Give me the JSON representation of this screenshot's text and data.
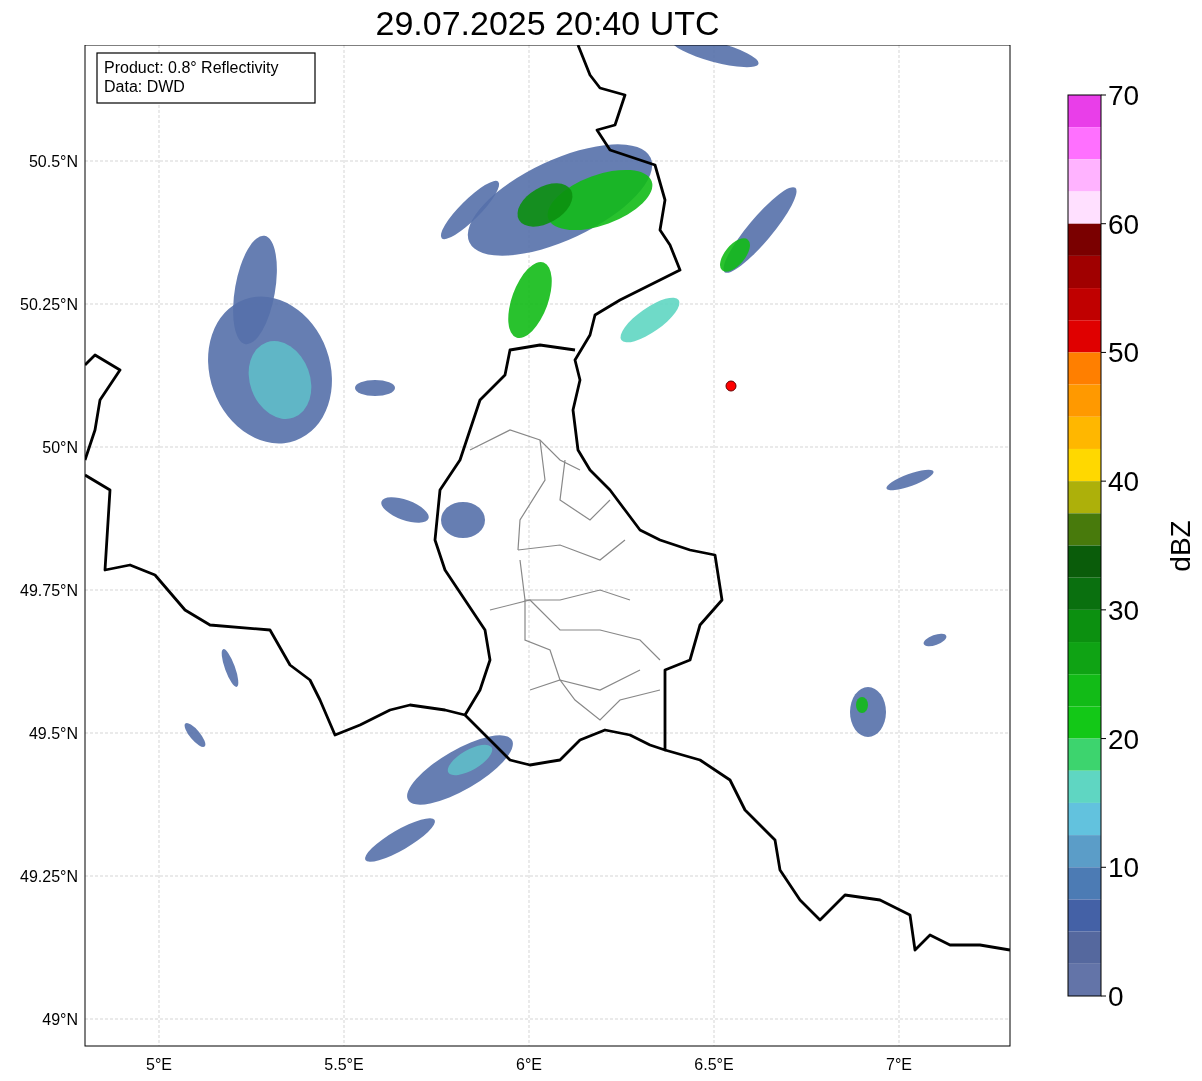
{
  "title": "29.07.2025 20:40 UTC",
  "info_box": {
    "lines": [
      "Product: 0.8° Reflectivity",
      "Data: DWD"
    ]
  },
  "map": {
    "y_ticks": [
      "50.5°N",
      "50.25°N",
      "50°N",
      "49.75°N",
      "49.5°N",
      "49.25°N",
      "49°N"
    ],
    "x_ticks": [
      "5°E",
      "5.5°E",
      "6°E",
      "6.5°E",
      "7°E"
    ]
  },
  "colorbar": {
    "label": "dBZ",
    "ticks": [
      "70",
      "60",
      "50",
      "40",
      "30",
      "20",
      "10",
      "0"
    ],
    "bins": [
      {
        "color": "#e93ee9"
      },
      {
        "color": "#ff70ff"
      },
      {
        "color": "#ffb3ff"
      },
      {
        "color": "#ffe0ff"
      },
      {
        "color": "#7a0000"
      },
      {
        "color": "#a00000"
      },
      {
        "color": "#c00000"
      },
      {
        "color": "#e00000"
      },
      {
        "color": "#ff7f00"
      },
      {
        "color": "#ff9900"
      },
      {
        "color": "#ffb700"
      },
      {
        "color": "#ffd800"
      },
      {
        "color": "#adb00a"
      },
      {
        "color": "#487a0c"
      },
      {
        "color": "#0a5c0a"
      },
      {
        "color": "#0a700f"
      },
      {
        "color": "#0c9010"
      },
      {
        "color": "#0fa314"
      },
      {
        "color": "#12bb17"
      },
      {
        "color": "#13c817"
      },
      {
        "color": "#3dd46e"
      },
      {
        "color": "#5fd6c2"
      },
      {
        "color": "#62c2de"
      },
      {
        "color": "#5b9dc8"
      },
      {
        "color": "#4c7bb4"
      },
      {
        "color": "#4461a6"
      },
      {
        "color": "#55689e"
      },
      {
        "color": "#6374a8"
      }
    ]
  }
}
